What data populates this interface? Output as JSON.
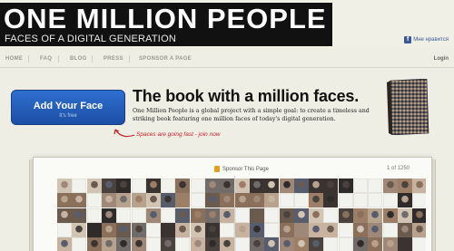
{
  "header": {
    "logo_title": "ONE MILLION PEOPLE",
    "logo_subtitle": "FACES OF A DIGITAL GENERATION",
    "fb_like_label": "Мне нравится"
  },
  "nav": {
    "items": [
      "HOME",
      "FAQ",
      "BLOG",
      "PRESS",
      "SPONSOR A PAGE"
    ],
    "login": "Login"
  },
  "hero": {
    "cta_title": "Add Your Face",
    "cta_sub": "It's free",
    "hint": "Spaces are going fast - join now",
    "headline": "The book with a million faces.",
    "blurb": "One Million People is a global project with a simple goal: to create a timeless and striking book featuring one million faces of today's digital generation."
  },
  "book_viewer": {
    "sponsor_label": "Sponsor This Page",
    "page_count": "1 of 1250"
  },
  "colors": {
    "cta_blue": "#2a62c0",
    "hint_red": "#c8202a",
    "background": "#efeee4"
  }
}
